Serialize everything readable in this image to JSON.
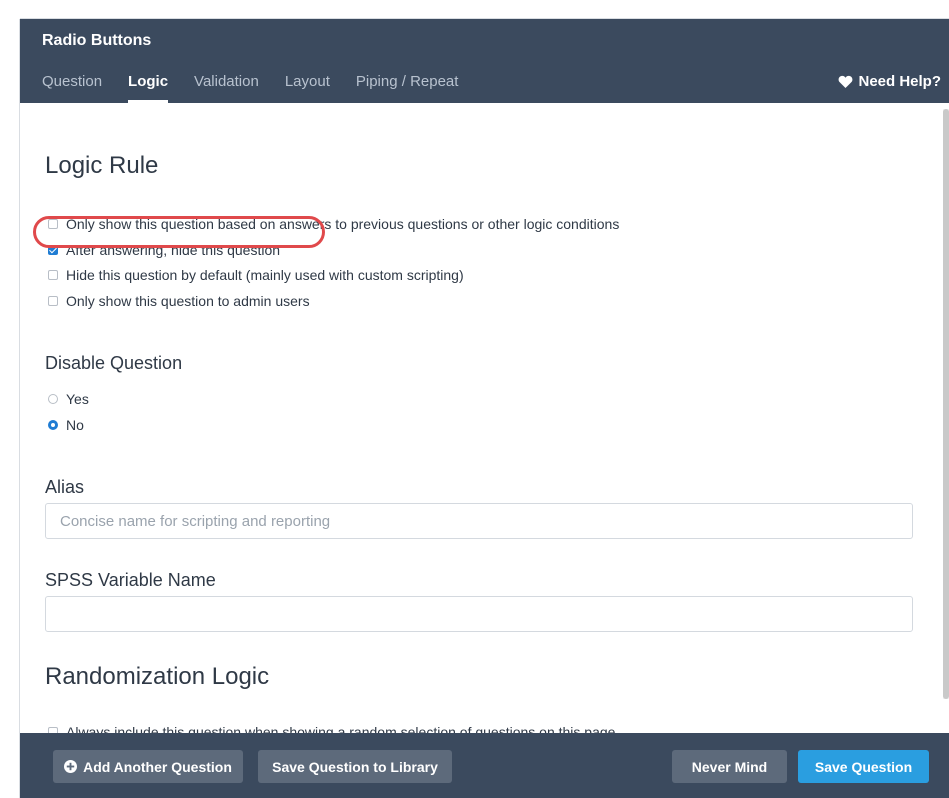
{
  "dialog": {
    "title": "Radio Buttons"
  },
  "tabs": [
    {
      "label": "Question",
      "active": false
    },
    {
      "label": "Logic",
      "active": true
    },
    {
      "label": "Validation",
      "active": false
    },
    {
      "label": "Layout",
      "active": false
    },
    {
      "label": "Piping / Repeat",
      "active": false
    }
  ],
  "help": {
    "label": "Need Help?",
    "icon": "heart-icon"
  },
  "logic_rule": {
    "heading": "Logic Rule",
    "options": [
      {
        "label": "Only show this question based on answers to previous questions or other logic conditions",
        "checked": false
      },
      {
        "label": "After answering, hide this question",
        "checked": true
      },
      {
        "label": "Hide this question by default (mainly used with custom scripting)",
        "checked": false
      },
      {
        "label": "Only show this question to admin users",
        "checked": false
      }
    ]
  },
  "disable_question": {
    "heading": "Disable Question",
    "options": [
      {
        "label": "Yes",
        "selected": false
      },
      {
        "label": "No",
        "selected": true
      }
    ]
  },
  "alias": {
    "label": "Alias",
    "placeholder": "Concise name for scripting and reporting",
    "value": ""
  },
  "spss": {
    "label": "SPSS Variable Name",
    "value": ""
  },
  "randomization": {
    "heading": "Randomization Logic",
    "options": [
      {
        "label": "Always include this question when showing a random selection of questions on this page",
        "checked": false
      }
    ]
  },
  "footer": {
    "add_another": "Add Another Question",
    "save_library": "Save Question to Library",
    "never_mind": "Never Mind",
    "save_question": "Save Question"
  },
  "colors": {
    "header_bg": "#3b4a5e",
    "accent_blue": "#2a9ee0",
    "checkbox_blue": "#1f7cd3",
    "annotation_red": "#e0494b"
  }
}
